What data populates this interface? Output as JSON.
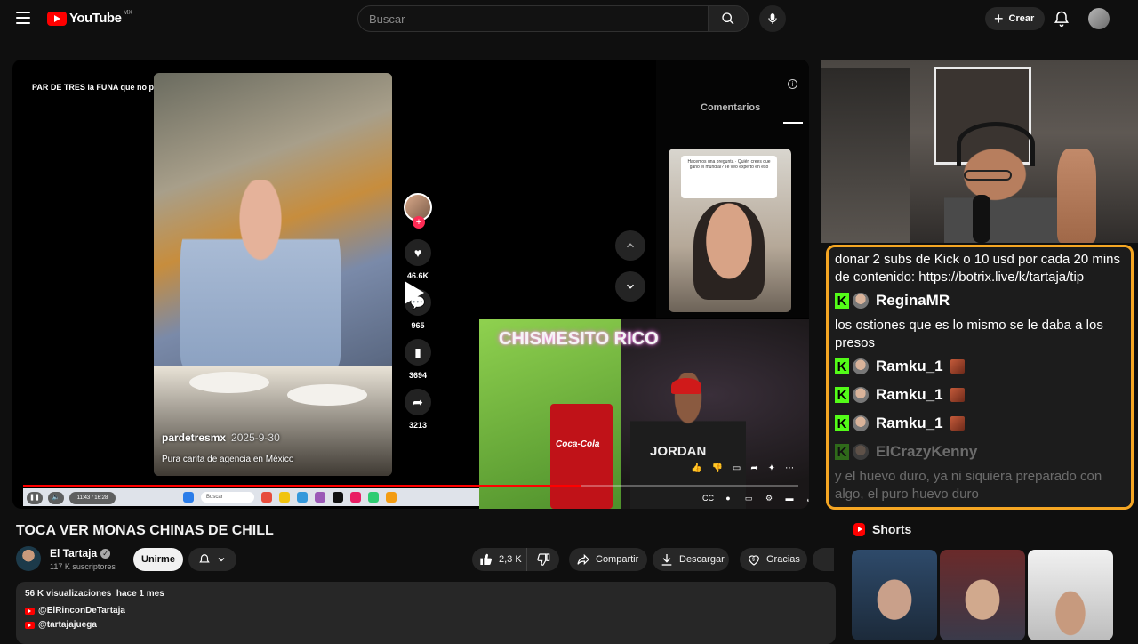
{
  "header": {
    "logo_text": "YouTube",
    "country": "MX",
    "search_placeholder": "Buscar",
    "create_label": "Crear"
  },
  "player": {
    "tiktok_title": "PAR DE TRES la FUNA que no pudieron ANULAR|Whitexicans detestables",
    "tiktok_user": "pardetresmx",
    "tiktok_date": "2025-9-30",
    "tiktok_caption": "Pura carita de agencia en México",
    "tiktok_counts": {
      "likes": "46.6K",
      "comments": "965",
      "saves": "3694",
      "shares": "3213"
    },
    "comments_tab": "Comentarios",
    "card_question": "Hacemos una pregunta · Quién crees que ganó el mundial? Te veo experto en eso",
    "stream_neon": "CHISMESITO RICO",
    "fridge_text": "Coca-Cola",
    "shirt_text": "JORDAN",
    "time_display": "11:43 / 16:28",
    "taskbar_search": "Buscar",
    "progress_fraction": 0.72
  },
  "chat": {
    "messages": [
      {
        "type": "text",
        "text": "donar 2 subs de Kick o 10 usd por cada 20 mins de contenido: https://botrix.live/k/tartaja/tip"
      },
      {
        "type": "user",
        "name": "ReginaMR"
      },
      {
        "type": "text",
        "text": "los ostiones que es lo mismo se le daba a los presos"
      },
      {
        "type": "user",
        "name": "Ramku_1"
      },
      {
        "type": "user",
        "name": "Ramku_1"
      },
      {
        "type": "user",
        "name": "Ramku_1"
      },
      {
        "type": "user",
        "name": "ElCrazyKenny"
      },
      {
        "type": "text",
        "text": "y el huevo duro, ya ni siquiera preparado con algo, el puro huevo duro"
      }
    ]
  },
  "video": {
    "title": "TOCA VER MONAS CHINAS DE CHILL",
    "channel_name": "El Tartaja",
    "subscribers": "117 K suscriptores",
    "join_label": "Unirme",
    "likes": "2,3 K",
    "share_label": "Compartir",
    "download_label": "Descargar",
    "thanks_label": "Gracias",
    "views": "56 K visualizaciones",
    "age": "hace 1 mes",
    "links": [
      "@ElRinconDeTartaja",
      "@tartajajuega"
    ]
  },
  "shorts": {
    "heading": "Shorts"
  },
  "colors": {
    "accent": "#ff0000",
    "chat_border": "#f5a623",
    "kick_green": "#53fc18"
  }
}
